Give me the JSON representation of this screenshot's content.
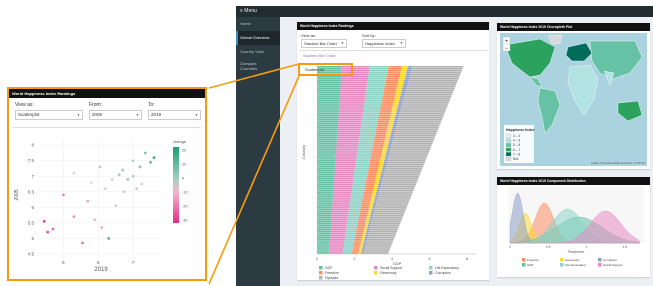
{
  "topbar": {
    "menu_label": "≡ Menu"
  },
  "sidebar": {
    "items": [
      {
        "label": "Home"
      },
      {
        "label": "Global Overview",
        "active": true
      },
      {
        "label": "Country View"
      },
      {
        "label": "Compare",
        "label2": "Countries"
      }
    ]
  },
  "rankings": {
    "title": "World Happiness Index Rankings",
    "view_label": "View as:",
    "view_value": "Stacked Bar Chart",
    "sort_label": "Sort by:",
    "sort_value": "Happiness Index",
    "dropdown_options": [
      "Stacked Bar Chart",
      "Scatterplot"
    ],
    "chart_data": {
      "type": "bar",
      "orientation": "horizontal",
      "ylabel": "Country",
      "xlabel": "GDP",
      "x_ticks": [
        "0",
        "2",
        "4",
        "6",
        "8"
      ],
      "legend": [
        {
          "name": "GDP",
          "color": "#66c2a5"
        },
        {
          "name": "Social Support",
          "color": "#e78ac3"
        },
        {
          "name": "Life Expectancy",
          "color": "#8dd3c7"
        },
        {
          "name": "Freedom",
          "color": "#fc8d62"
        },
        {
          "name": "Generosity",
          "color": "#ffd92f"
        },
        {
          "name": "Corruption",
          "color": "#8da0cb"
        },
        {
          "name": "Dystopia",
          "color": "#b3b3b3"
        }
      ]
    }
  },
  "map": {
    "title": "World Happiness Index 2019 Choropleth Plot",
    "zoom_in": "+",
    "zoom_out": "−",
    "legend_title": "Happiness Index",
    "legend": [
      {
        "label": "3 – 4",
        "color": "#e0f3f0"
      },
      {
        "label": "4 – 5",
        "color": "#b2e2e2"
      },
      {
        "label": "5 – 6",
        "color": "#66c2a4"
      },
      {
        "label": "6 – 7",
        "color": "#2ca25f"
      },
      {
        "label": "7 – 8",
        "color": "#006d5b"
      },
      {
        "label": "N/A",
        "color": "#d9d9d9"
      }
    ],
    "attribution": "Leaflet | © OpenStreetMap contributors, CC-BY-SA"
  },
  "distribution": {
    "title": "World Happiness Index 2019 Component Distribution",
    "xlabel": "Parameter",
    "x_ticks": [
      "0",
      "0.5",
      "1",
      "1.5"
    ],
    "legend": [
      {
        "name": "Freedom",
        "color": "#fc8d62"
      },
      {
        "name": "Generosity",
        "color": "#ffd92f"
      },
      {
        "name": "Corruption",
        "color": "#8da0cb"
      },
      {
        "name": "GDP",
        "color": "#66c2a5"
      },
      {
        "name": "Life Expectancy",
        "color": "#8dd3c7"
      },
      {
        "name": "Social Support",
        "color": "#e78ac3"
      }
    ]
  },
  "inset": {
    "title": "World Happiness Index Rankings",
    "view_label": "View as:",
    "view_value": "Scatterplot",
    "from_label": "From:",
    "from_value": "2005",
    "to_label": "To:",
    "to_value": "2019",
    "chart_data": {
      "type": "scatter",
      "xlabel": "2019",
      "ylabel": "2005",
      "x_ticks": [
        5,
        6,
        7
      ],
      "xlim": [
        4.3,
        7.8
      ],
      "y_ticks": [
        4.5,
        5,
        5.5,
        6,
        6.5,
        7,
        7.5,
        8
      ],
      "ylim": [
        4.4,
        8.2
      ],
      "colorbar_title": "change",
      "colorbar_ticks": [
        20,
        10,
        0,
        -10,
        -20,
        -30
      ],
      "colorbar_range": [
        -32,
        22
      ],
      "points": [
        {
          "x": 4.45,
          "y": 5.55,
          "c": -28
        },
        {
          "x": 4.55,
          "y": 5.2,
          "c": -25
        },
        {
          "x": 4.7,
          "y": 5.3,
          "c": -20
        },
        {
          "x": 5.0,
          "y": 6.4,
          "c": -15
        },
        {
          "x": 5.3,
          "y": 5.7,
          "c": -12
        },
        {
          "x": 5.3,
          "y": 7.1,
          "c": 2
        },
        {
          "x": 5.55,
          "y": 4.85,
          "c": -18
        },
        {
          "x": 5.7,
          "y": 6.2,
          "c": -10
        },
        {
          "x": 5.8,
          "y": 6.8,
          "c": 0
        },
        {
          "x": 5.9,
          "y": 5.6,
          "c": -6
        },
        {
          "x": 6.05,
          "y": 7.3,
          "c": 5
        },
        {
          "x": 6.1,
          "y": 5.35,
          "c": -8
        },
        {
          "x": 6.2,
          "y": 6.6,
          "c": -3
        },
        {
          "x": 6.3,
          "y": 5.0,
          "c": 15
        },
        {
          "x": 6.4,
          "y": 6.9,
          "c": 3
        },
        {
          "x": 6.5,
          "y": 6.05,
          "c": -5
        },
        {
          "x": 6.6,
          "y": 7.05,
          "c": 6
        },
        {
          "x": 6.7,
          "y": 7.2,
          "c": 7
        },
        {
          "x": 6.75,
          "y": 6.5,
          "c": 4
        },
        {
          "x": 6.85,
          "y": 6.9,
          "c": 8
        },
        {
          "x": 7.0,
          "y": 7.5,
          "c": 5
        },
        {
          "x": 7.0,
          "y": 7.0,
          "c": 6
        },
        {
          "x": 7.1,
          "y": 6.6,
          "c": 4
        },
        {
          "x": 7.2,
          "y": 7.3,
          "c": 9
        },
        {
          "x": 7.25,
          "y": 6.75,
          "c": 3
        },
        {
          "x": 7.35,
          "y": 7.75,
          "c": 10
        },
        {
          "x": 7.5,
          "y": 7.45,
          "c": 14
        },
        {
          "x": 7.6,
          "y": 7.6,
          "c": 18
        }
      ]
    }
  }
}
